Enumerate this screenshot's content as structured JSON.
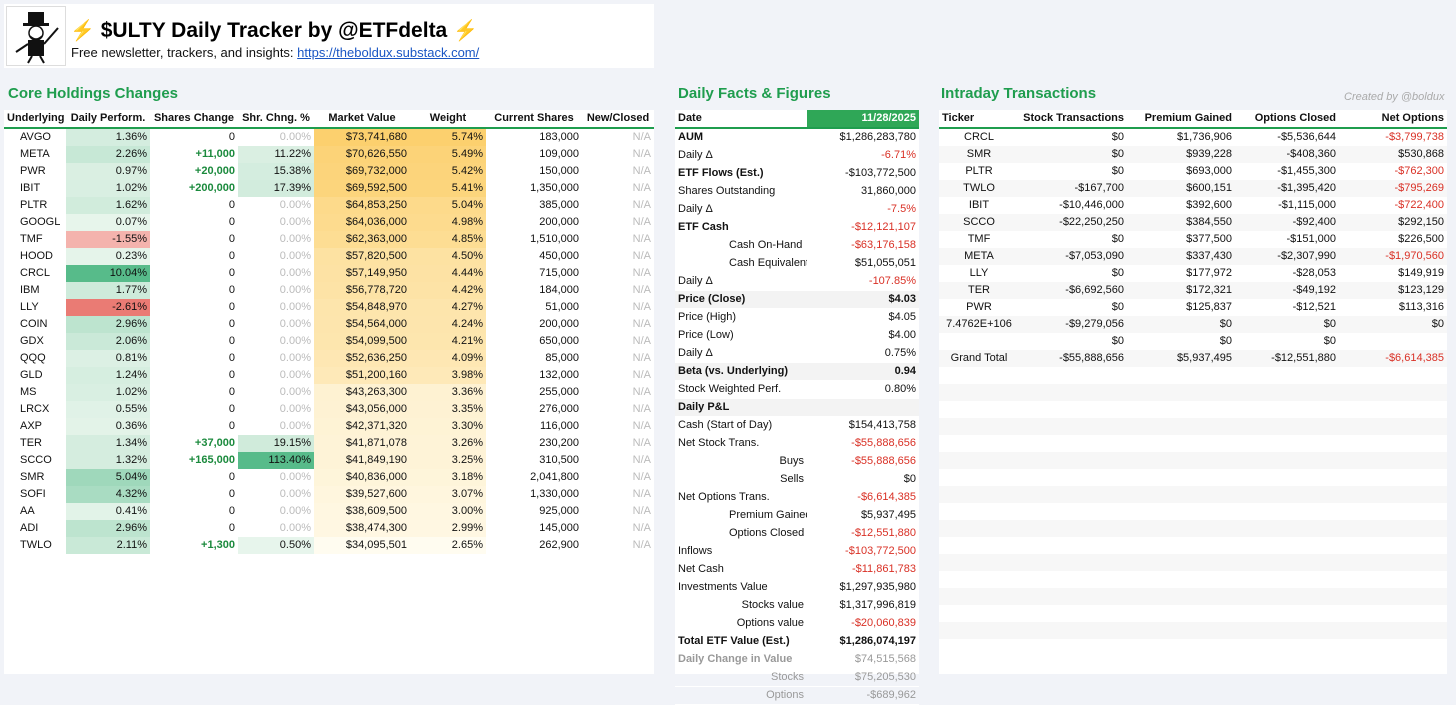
{
  "header": {
    "title": "$ULTY Daily Tracker by @ETFdelta",
    "subtitle_prefix": "Free newsletter, trackers, and insights: ",
    "link": "https://theboldux.substack.com/",
    "credit": "Created by @boldux"
  },
  "colors": {
    "accent": "#1f9d4e",
    "negative": "#d93025",
    "positive": "#1b8a3d"
  },
  "core": {
    "title": "Core Holdings Changes",
    "columns": [
      "Underlying",
      "Daily Perform.",
      "Shares Change",
      "Shr. Chng. %",
      "Market Value",
      "Weight",
      "Current Shares",
      "New/Closed"
    ],
    "rows": [
      [
        "AVGO",
        "1.36%",
        "0",
        "0.00%",
        "$73,741,680",
        "5.74%",
        "183,000",
        "N/A"
      ],
      [
        "META",
        "2.26%",
        "+11,000",
        "11.22%",
        "$70,626,550",
        "5.49%",
        "109,000",
        "N/A"
      ],
      [
        "PWR",
        "0.97%",
        "+20,000",
        "15.38%",
        "$69,732,000",
        "5.42%",
        "150,000",
        "N/A"
      ],
      [
        "IBIT",
        "1.02%",
        "+200,000",
        "17.39%",
        "$69,592,500",
        "5.41%",
        "1,350,000",
        "N/A"
      ],
      [
        "PLTR",
        "1.62%",
        "0",
        "0.00%",
        "$64,853,250",
        "5.04%",
        "385,000",
        "N/A"
      ],
      [
        "GOOGL",
        "0.07%",
        "0",
        "0.00%",
        "$64,036,000",
        "4.98%",
        "200,000",
        "N/A"
      ],
      [
        "TMF",
        "-1.55%",
        "0",
        "0.00%",
        "$62,363,000",
        "4.85%",
        "1,510,000",
        "N/A"
      ],
      [
        "HOOD",
        "0.23%",
        "0",
        "0.00%",
        "$57,820,500",
        "4.50%",
        "450,000",
        "N/A"
      ],
      [
        "CRCL",
        "10.04%",
        "0",
        "0.00%",
        "$57,149,950",
        "4.44%",
        "715,000",
        "N/A"
      ],
      [
        "IBM",
        "1.77%",
        "0",
        "0.00%",
        "$56,778,720",
        "4.42%",
        "184,000",
        "N/A"
      ],
      [
        "LLY",
        "-2.61%",
        "0",
        "0.00%",
        "$54,848,970",
        "4.27%",
        "51,000",
        "N/A"
      ],
      [
        "COIN",
        "2.96%",
        "0",
        "0.00%",
        "$54,564,000",
        "4.24%",
        "200,000",
        "N/A"
      ],
      [
        "GDX",
        "2.06%",
        "0",
        "0.00%",
        "$54,099,500",
        "4.21%",
        "650,000",
        "N/A"
      ],
      [
        "QQQ",
        "0.81%",
        "0",
        "0.00%",
        "$52,636,250",
        "4.09%",
        "85,000",
        "N/A"
      ],
      [
        "GLD",
        "1.24%",
        "0",
        "0.00%",
        "$51,200,160",
        "3.98%",
        "132,000",
        "N/A"
      ],
      [
        "MS",
        "1.02%",
        "0",
        "0.00%",
        "$43,263,300",
        "3.36%",
        "255,000",
        "N/A"
      ],
      [
        "LRCX",
        "0.55%",
        "0",
        "0.00%",
        "$43,056,000",
        "3.35%",
        "276,000",
        "N/A"
      ],
      [
        "AXP",
        "0.36%",
        "0",
        "0.00%",
        "$42,371,320",
        "3.30%",
        "116,000",
        "N/A"
      ],
      [
        "TER",
        "1.34%",
        "+37,000",
        "19.15%",
        "$41,871,078",
        "3.26%",
        "230,200",
        "N/A"
      ],
      [
        "SCCO",
        "1.32%",
        "+165,000",
        "113.40%",
        "$41,849,190",
        "3.25%",
        "310,500",
        "N/A"
      ],
      [
        "SMR",
        "5.04%",
        "0",
        "0.00%",
        "$40,836,000",
        "3.18%",
        "2,041,800",
        "N/A"
      ],
      [
        "SOFI",
        "4.32%",
        "0",
        "0.00%",
        "$39,527,600",
        "3.07%",
        "1,330,000",
        "N/A"
      ],
      [
        "AA",
        "0.41%",
        "0",
        "0.00%",
        "$38,609,500",
        "3.00%",
        "925,000",
        "N/A"
      ],
      [
        "ADI",
        "2.96%",
        "0",
        "0.00%",
        "$38,474,300",
        "2.99%",
        "145,000",
        "N/A"
      ],
      [
        "TWLO",
        "2.11%",
        "+1,300",
        "0.50%",
        "$34,095,501",
        "2.65%",
        "262,900",
        "N/A"
      ]
    ]
  },
  "facts": {
    "title": "Daily Facts & Figures",
    "rows": [
      {
        "label": "Date",
        "value": "11/28/2025",
        "style": "date"
      },
      {
        "label": "AUM",
        "value": "$1,286,283,780",
        "style": "bold sep"
      },
      {
        "label": "Daily Δ",
        "value": "-6.71%",
        "style": "neg"
      },
      {
        "label": "ETF Flows (Est.)",
        "value": "-$103,772,500",
        "style": "bold sep"
      },
      {
        "label": "Shares Outstanding",
        "value": "31,860,000",
        "style": ""
      },
      {
        "label": "Daily Δ",
        "value": "-7.5%",
        "style": "neg"
      },
      {
        "label": "ETF Cash",
        "value": "-$12,121,107",
        "style": "bold sep neg"
      },
      {
        "label": "Cash On-Hand",
        "value": "-$63,176,158",
        "style": "indent neg"
      },
      {
        "label": "Cash Equivalents",
        "value": "$51,055,051",
        "style": "indent"
      },
      {
        "label": "Daily Δ",
        "value": "-107.85%",
        "style": "neg"
      },
      {
        "label": "Price (Close)",
        "value": "$4.03",
        "style": "bold sep gray boldval"
      },
      {
        "label": "Price (High)",
        "value": "$4.05",
        "style": ""
      },
      {
        "label": "Price (Low)",
        "value": "$4.00",
        "style": ""
      },
      {
        "label": "Daily Δ",
        "value": "0.75%",
        "style": ""
      },
      {
        "label": "Beta (vs. Underlying)",
        "value": "0.94",
        "style": "bold sep gray boldval"
      },
      {
        "label": "Stock Weighted Perf.",
        "value": "0.80%",
        "style": ""
      },
      {
        "label": "Daily P&L",
        "value": "",
        "style": "bold sep gray"
      },
      {
        "label": "Cash (Start of Day)",
        "value": "$154,413,758",
        "style": ""
      },
      {
        "label": "Net Stock Trans.",
        "value": "-$55,888,656",
        "style": "neg"
      },
      {
        "label": "Buys",
        "value": "-$55,888,656",
        "style": "indent2 neg"
      },
      {
        "label": "Sells",
        "value": "$0",
        "style": "indent2"
      },
      {
        "label": "Net Options Trans.",
        "value": "-$6,614,385",
        "style": "sep neg"
      },
      {
        "label": "Premium Gained",
        "value": "$5,937,495",
        "style": "indent"
      },
      {
        "label": "Options Closed",
        "value": "-$12,551,880",
        "style": "indent neg"
      },
      {
        "label": "Inflows",
        "value": "-$103,772,500",
        "style": "sep neg"
      },
      {
        "label": "Net Cash",
        "value": "-$11,861,783",
        "style": "sep neg"
      },
      {
        "label": "Investments Value",
        "value": "$1,297,935,980",
        "style": ""
      },
      {
        "label": "Stocks value",
        "value": "$1,317,996,819",
        "style": "indent2"
      },
      {
        "label": "Options value",
        "value": "-$20,060,839",
        "style": "indent2 neg"
      },
      {
        "label": "Total ETF Value (Est.)",
        "value": "$1,286,074,197",
        "style": "total"
      },
      {
        "label": "Daily Change in Value",
        "value": "$74,515,568",
        "style": "mutebold"
      },
      {
        "label": "Stocks",
        "value": "$75,205,530",
        "style": "mute indent2"
      },
      {
        "label": "Options",
        "value": "-$689,962",
        "style": "mute indent2"
      }
    ]
  },
  "intraday": {
    "title": "Intraday Transactions",
    "columns": [
      "Ticker",
      "Stock Transactions",
      "Premium Gained",
      "Options Closed",
      "Net Options"
    ],
    "rows": [
      [
        "CRCL",
        "$0",
        "$1,736,906",
        "-$5,536,644",
        "-$3,799,738"
      ],
      [
        "SMR",
        "$0",
        "$939,228",
        "-$408,360",
        "$530,868"
      ],
      [
        "PLTR",
        "$0",
        "$693,000",
        "-$1,455,300",
        "-$762,300"
      ],
      [
        "TWLO",
        "-$167,700",
        "$600,151",
        "-$1,395,420",
        "-$795,269"
      ],
      [
        "IBIT",
        "-$10,446,000",
        "$392,600",
        "-$1,115,000",
        "-$722,400"
      ],
      [
        "SCCO",
        "-$22,250,250",
        "$384,550",
        "-$92,400",
        "$292,150"
      ],
      [
        "TMF",
        "$0",
        "$377,500",
        "-$151,000",
        "$226,500"
      ],
      [
        "META",
        "-$7,053,090",
        "$337,430",
        "-$2,307,990",
        "-$1,970,560"
      ],
      [
        "LLY",
        "$0",
        "$177,972",
        "-$28,053",
        "$149,919"
      ],
      [
        "TER",
        "-$6,692,560",
        "$172,321",
        "-$49,192",
        "$123,129"
      ],
      [
        "PWR",
        "$0",
        "$125,837",
        "-$12,521",
        "$113,316"
      ],
      [
        "7.4762E+106",
        "-$9,279,056",
        "$0",
        "$0",
        "$0"
      ],
      [
        "",
        "$0",
        "$0",
        "$0",
        ""
      ],
      [
        "Grand Total",
        "-$55,888,656",
        "$5,937,495",
        "-$12,551,880",
        "-$6,614,385"
      ]
    ]
  }
}
